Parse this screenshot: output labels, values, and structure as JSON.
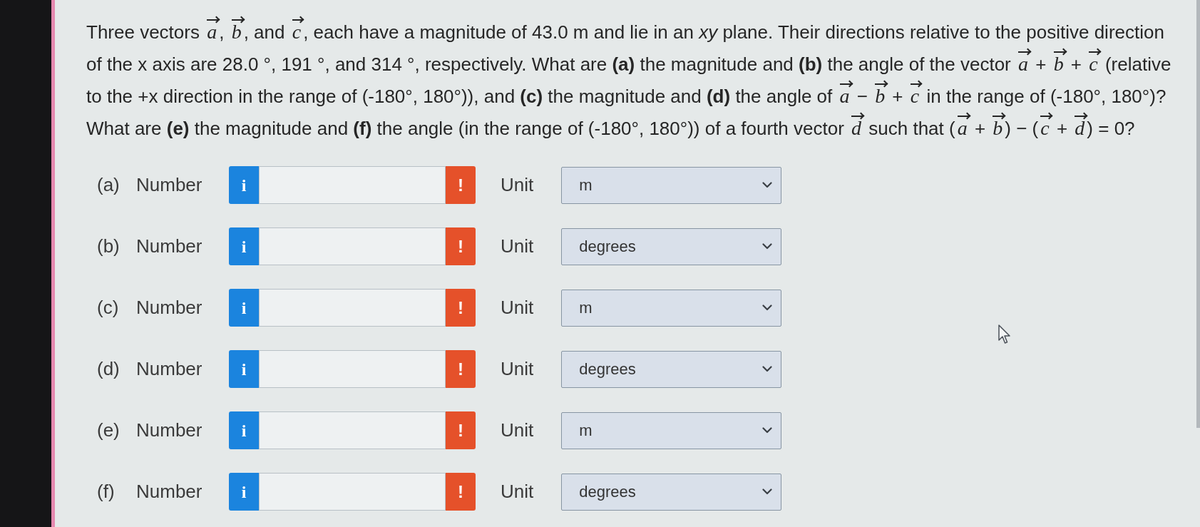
{
  "question": {
    "parts": [
      {
        "kind": "text",
        "text": "Three vectors "
      },
      {
        "kind": "vector",
        "text": "a"
      },
      {
        "kind": "text",
        "text": ", "
      },
      {
        "kind": "vector",
        "text": "b"
      },
      {
        "kind": "text",
        "text": ", and "
      },
      {
        "kind": "vector",
        "text": "c"
      },
      {
        "kind": "text",
        "text": ", each have a magnitude of 43.0 m and lie in an *xy* plane. Their directions relative to the positive direction of the x axis are 28.0 °, 191 °, and 314 °, respectively. What are **(a)** the magnitude and **(b)** the angle of the vector "
      },
      {
        "kind": "vector",
        "text": "a"
      },
      {
        "kind": "text",
        "text": " + "
      },
      {
        "kind": "vector",
        "text": "b"
      },
      {
        "kind": "text",
        "text": " + "
      },
      {
        "kind": "vector",
        "text": "c"
      },
      {
        "kind": "text",
        "text": " (relative to the +x direction in the range of (-180°, 180°)), and **(c)** the magnitude and **(d)** the angle of "
      },
      {
        "kind": "vector",
        "text": "a"
      },
      {
        "kind": "text",
        "text": " − "
      },
      {
        "kind": "vector",
        "text": "b"
      },
      {
        "kind": "text",
        "text": " + "
      },
      {
        "kind": "vector",
        "text": "c"
      },
      {
        "kind": "text",
        "text": " in the range of (-180°, 180°)? What are **(e)** the magnitude and **(f)** the angle (in the range of (-180°, 180°)) of a fourth vector "
      },
      {
        "kind": "vector",
        "text": "d"
      },
      {
        "kind": "text",
        "text": " such that ("
      },
      {
        "kind": "vector",
        "text": "a"
      },
      {
        "kind": "text",
        "text": " + "
      },
      {
        "kind": "vector",
        "text": "b"
      },
      {
        "kind": "text",
        "text": ") − ("
      },
      {
        "kind": "vector",
        "text": "c"
      },
      {
        "kind": "text",
        "text": " + "
      },
      {
        "kind": "vector",
        "text": "d"
      },
      {
        "kind": "text",
        "text": ") = 0?"
      }
    ]
  },
  "answers": [
    {
      "part": "(a)",
      "field_label": "Number",
      "info_button": "i",
      "alert_button": "!",
      "unit_label": "Unit",
      "unit": "m"
    },
    {
      "part": "(b)",
      "field_label": "Number",
      "info_button": "i",
      "alert_button": "!",
      "unit_label": "Unit",
      "unit": "degrees"
    },
    {
      "part": "(c)",
      "field_label": "Number",
      "info_button": "i",
      "alert_button": "!",
      "unit_label": "Unit",
      "unit": "m"
    },
    {
      "part": "(d)",
      "field_label": "Number",
      "info_button": "i",
      "alert_button": "!",
      "unit_label": "Unit",
      "unit": "degrees"
    },
    {
      "part": "(e)",
      "field_label": "Number",
      "info_button": "i",
      "alert_button": "!",
      "unit_label": "Unit",
      "unit": "m"
    },
    {
      "part": "(f)",
      "field_label": "Number",
      "info_button": "i",
      "alert_button": "!",
      "unit_label": "Unit",
      "unit": "degrees"
    }
  ]
}
